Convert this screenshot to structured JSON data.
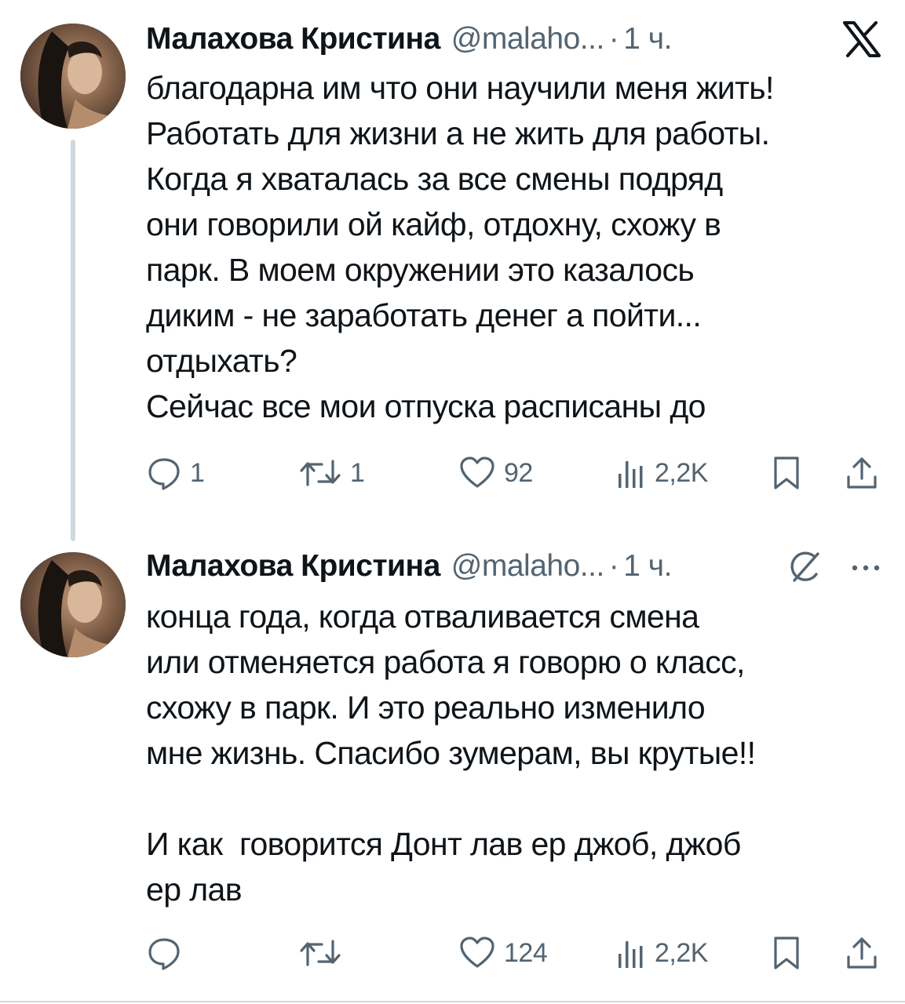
{
  "thread": [
    {
      "author": {
        "name": "Малахова Кристина",
        "handle": "@malaho...",
        "separator": "·",
        "time": "1 ч."
      },
      "text": "благодарна им что они научили меня жить!\nРаботать для жизни а не жить для работы.\nКогда я хваталась за все смены подряд\nони говорили ой кайф, отдохну, схожу в\nпарк. В моем окружении это казалось\nдиким - не заработать денег а пойти...\nотдыхать?\nСейчас все мои отпуска расписаны до",
      "corner_icon": "x-logo-icon",
      "stats": {
        "replies": "1",
        "reposts": "1",
        "likes": "92",
        "views": "2,2K"
      }
    },
    {
      "author": {
        "name": "Малахова Кристина",
        "handle": "@malaho...",
        "separator": "·",
        "time": "1 ч."
      },
      "text": "конца года, когда отваливается смена\nили отменяется работа я говорю о класс,\nсхожу в парк. И это реально изменило\nмне жизнь. Спасибо зумерам, вы крутые!!\n\nИ как  говорится Донт лав ер джоб, джоб\nер лав",
      "corner_icons": [
        "grok-icon",
        "more-icon"
      ],
      "stats": {
        "replies": "",
        "reposts": "",
        "likes": "124",
        "views": "2,2K"
      }
    }
  ],
  "colors": {
    "text_primary": "#0f1419",
    "text_secondary": "#536471",
    "thread_line": "#cfd9de",
    "background": "#ffffff"
  }
}
